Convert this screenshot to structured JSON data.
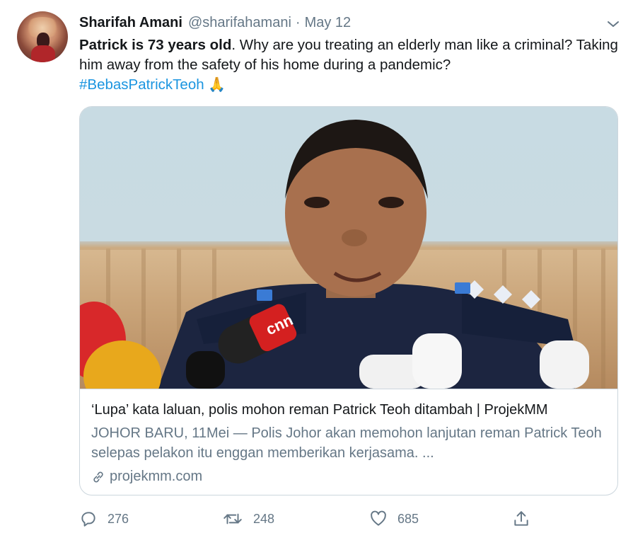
{
  "tweet": {
    "author_name": "Sharifah Amani",
    "author_handle": "@sharifahamani",
    "separator": "·",
    "date": "May 12",
    "text_bold": "Patrick is 73 years old",
    "text_rest": ". Why are you treating an elderly man like a criminal? Taking him away from the safety of his home during a pandemic?",
    "hashtag": "#BebasPatrickTeoh",
    "emoji": "🙏"
  },
  "card": {
    "title": "‘Lupa’ kata laluan, polis mohon reman Patrick Teoh ditambah | ProjekMM",
    "description": "JOHOR BARU, 11Mei — Polis Johor akan memohon lanjutan reman Patrick Teoh selepas pelakon itu enggan memberikan kerjasama.  ...",
    "domain": "projekmm.com",
    "image_label": "cnn"
  },
  "actions": {
    "replies": "276",
    "retweets": "248",
    "likes": "685"
  },
  "icons": [
    "caret-down-icon",
    "link-icon",
    "reply-icon",
    "retweet-icon",
    "like-icon",
    "share-icon"
  ],
  "colors": {
    "accent": "#1b95e0",
    "secondary_text": "#657786",
    "border": "#ccd6dd"
  }
}
